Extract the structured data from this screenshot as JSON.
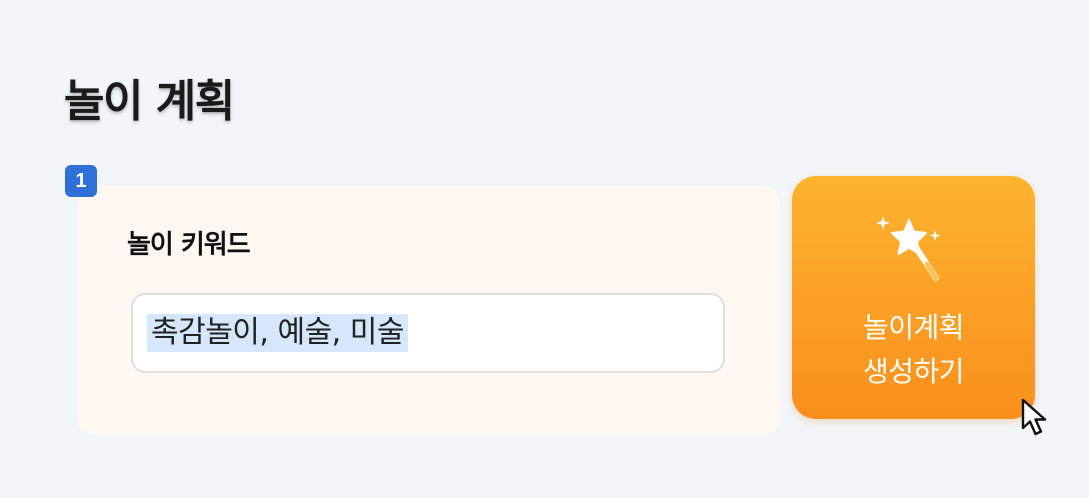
{
  "page": {
    "title": "놀이 계획"
  },
  "step": {
    "number": "1"
  },
  "keyword_card": {
    "label": "놀이 키워드",
    "input_value": "촉감놀이, 예술, 미술"
  },
  "generate_button": {
    "line1": "놀이계획",
    "line2": "생성하기",
    "icon": "magic-wand-icon"
  },
  "colors": {
    "background": "#f3f6f8",
    "card_background": "#fff8f1",
    "badge_blue": "#2e6fd8",
    "button_orange_top": "#fdb42f",
    "button_orange_bottom": "#f98f1d",
    "selection_highlight": "#d6e6fb"
  },
  "icons": {
    "cursor": "mouse-pointer-icon"
  }
}
